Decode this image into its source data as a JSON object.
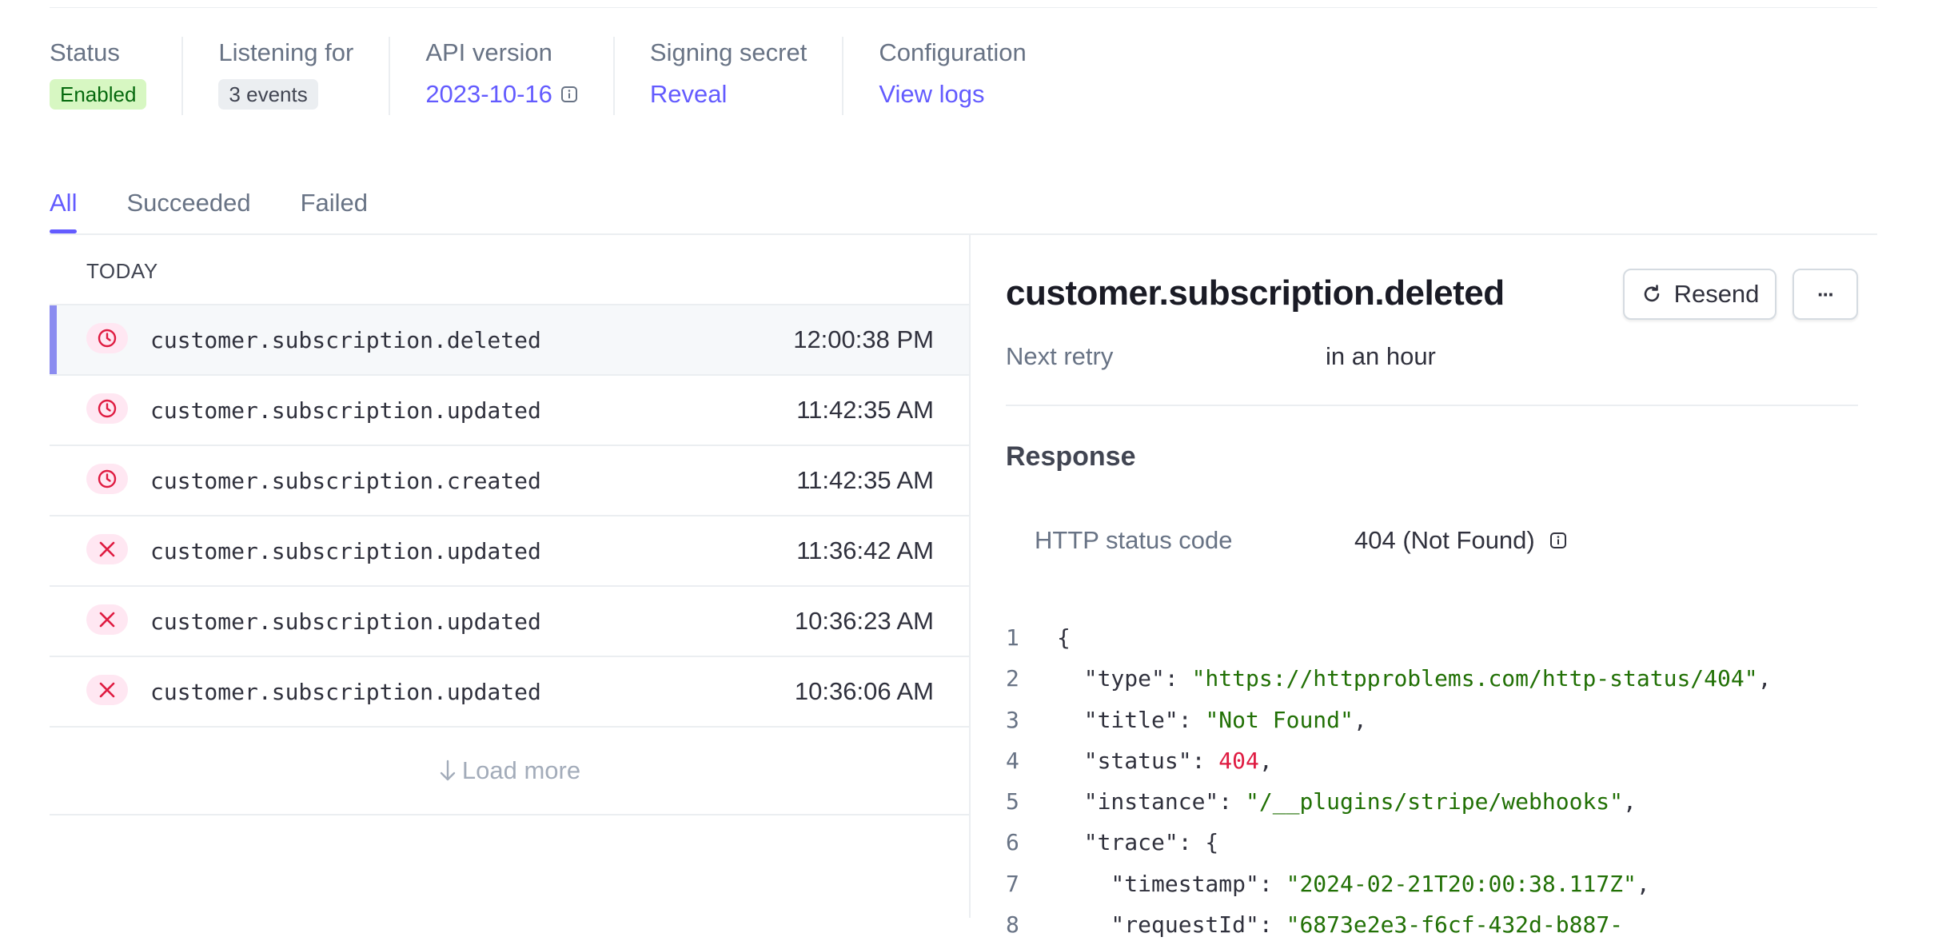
{
  "summary": {
    "status_label": "Status",
    "status_value": "Enabled",
    "listening_label": "Listening for",
    "listening_value": "3 events",
    "api_label": "API version",
    "api_value": "2023-10-16",
    "secret_label": "Signing secret",
    "secret_value": "Reveal",
    "config_label": "Configuration",
    "config_value": "View logs"
  },
  "tabs": [
    {
      "label": "All",
      "active": true
    },
    {
      "label": "Succeeded",
      "active": false
    },
    {
      "label": "Failed",
      "active": false
    }
  ],
  "list": {
    "group_label": "TODAY",
    "rows": [
      {
        "event": "customer.subscription.deleted",
        "time": "12:00:38 PM",
        "icon": "clock-icon",
        "selected": true
      },
      {
        "event": "customer.subscription.updated",
        "time": "11:42:35 AM",
        "icon": "clock-icon",
        "selected": false
      },
      {
        "event": "customer.subscription.created",
        "time": "11:42:35 AM",
        "icon": "clock-icon",
        "selected": false
      },
      {
        "event": "customer.subscription.updated",
        "time": "11:36:42 AM",
        "icon": "x-icon",
        "selected": false
      },
      {
        "event": "customer.subscription.updated",
        "time": "10:36:23 AM",
        "icon": "x-icon",
        "selected": false
      },
      {
        "event": "customer.subscription.updated",
        "time": "10:36:06 AM",
        "icon": "x-icon",
        "selected": false
      }
    ],
    "load_more_label": "Load more"
  },
  "detail": {
    "title": "customer.subscription.deleted",
    "resend_label": "Resend",
    "more_label": "···",
    "next_retry_label": "Next retry",
    "next_retry_value": "in an hour",
    "response_title": "Response",
    "http_status_label": "HTTP status code",
    "http_status_value": "404 (Not Found)",
    "code_lines": [
      {
        "n": "1",
        "tokens": [
          {
            "t": "{",
            "c": "punc"
          }
        ]
      },
      {
        "n": "2",
        "tokens": [
          {
            "t": "  \"type\"",
            "c": "key"
          },
          {
            "t": ": ",
            "c": "punc"
          },
          {
            "t": "\"https://httpproblems.com/http-status/404\"",
            "c": "str"
          },
          {
            "t": ",",
            "c": "punc"
          }
        ]
      },
      {
        "n": "3",
        "tokens": [
          {
            "t": "  \"title\"",
            "c": "key"
          },
          {
            "t": ": ",
            "c": "punc"
          },
          {
            "t": "\"Not Found\"",
            "c": "str"
          },
          {
            "t": ",",
            "c": "punc"
          }
        ]
      },
      {
        "n": "4",
        "tokens": [
          {
            "t": "  \"status\"",
            "c": "key"
          },
          {
            "t": ": ",
            "c": "punc"
          },
          {
            "t": "404",
            "c": "num"
          },
          {
            "t": ",",
            "c": "punc"
          }
        ]
      },
      {
        "n": "5",
        "tokens": [
          {
            "t": "  \"instance\"",
            "c": "key"
          },
          {
            "t": ": ",
            "c": "punc"
          },
          {
            "t": "\"/__plugins/stripe/webhooks\"",
            "c": "str"
          },
          {
            "t": ",",
            "c": "punc"
          }
        ]
      },
      {
        "n": "6",
        "tokens": [
          {
            "t": "  \"trace\"",
            "c": "key"
          },
          {
            "t": ": {",
            "c": "punc"
          }
        ]
      },
      {
        "n": "7",
        "tokens": [
          {
            "t": "    \"timestamp\"",
            "c": "key"
          },
          {
            "t": ": ",
            "c": "punc"
          },
          {
            "t": "\"2024-02-21T20:00:38.117Z\"",
            "c": "str"
          },
          {
            "t": ",",
            "c": "punc"
          }
        ]
      },
      {
        "n": "8",
        "tokens": [
          {
            "t": "    \"requestId\"",
            "c": "key"
          },
          {
            "t": ": ",
            "c": "punc"
          },
          {
            "t": "\"6873e2e3-f6cf-432d-b887-",
            "c": "str"
          }
        ]
      }
    ]
  },
  "colors": {
    "accent": "#635bff",
    "danger": "#df1b41",
    "success_bg": "#d7f7c2",
    "success_text": "#05690d",
    "code_string": "#217005"
  }
}
